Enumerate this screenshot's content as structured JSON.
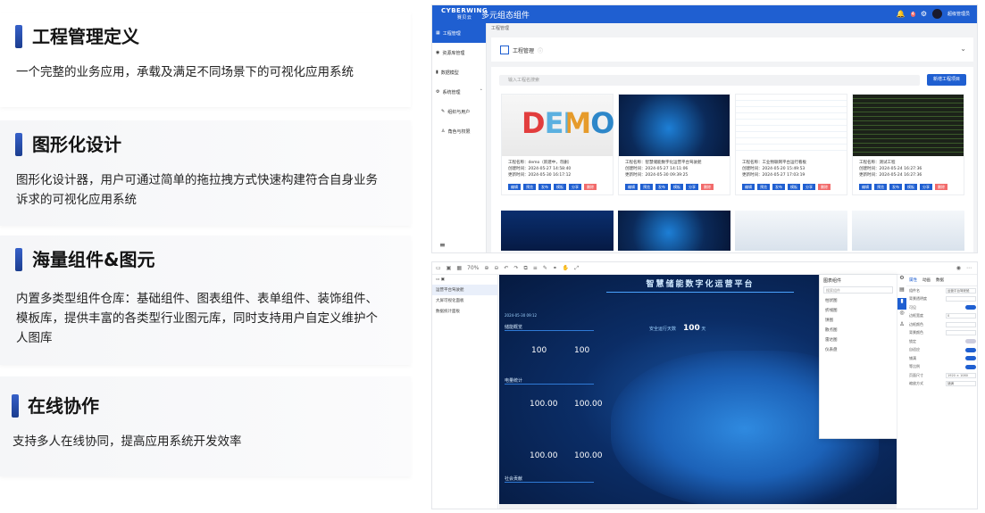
{
  "features": [
    {
      "title": "工程管理定义",
      "desc": "一个完整的业务应用，承载及满足不同场景下的可视化应用系统"
    },
    {
      "title": "图形化设计",
      "desc": "图形化设计器，用户可通过简单的拖拉拽方式快速构建符合自身业务诉求的可视化应用系统"
    },
    {
      "title": "海量组件&图元",
      "desc": "内置多类型组件仓库：基础组件、图表组件、表单组件、装饰组件、模板库，提供丰富的各类型行业图元库，同时支持用户自定义维护个人图库"
    },
    {
      "title": "在线协作",
      "desc": "支持多人在线协同，提高应用系统开发效率"
    }
  ],
  "app": {
    "brand": "CYBERWING",
    "brand_cn": "赛贝云",
    "title": "多元组态组件",
    "user": "超级管理员",
    "notif_count": "4",
    "sidebar": [
      {
        "label": "工程管理",
        "active": true,
        "icon": "grid-icon"
      },
      {
        "label": "资源库管理",
        "icon": "database-icon"
      },
      {
        "label": "数据模型",
        "icon": "chart-icon"
      },
      {
        "label": "系统管理",
        "icon": "gear-icon"
      },
      {
        "label": "组织与用户",
        "icon": "pen-icon",
        "sub": true
      },
      {
        "label": "角色与权限",
        "icon": "user-icon",
        "sub": true
      }
    ],
    "breadcrumb": "工程管理",
    "panel_title": "工程管理",
    "search_placeholder": "输入工程名搜索",
    "new_button": "新增工程项目",
    "card_buttons": [
      "编辑",
      "预览",
      "发布",
      "模板",
      "分享",
      "删除"
    ],
    "projects": [
      {
        "name": "工程名称：demo（新建中，勿删）",
        "created": "创建时间：2024-05-27 14:58:40",
        "updated": "更新时间：2024-05-30 16:17:12"
      },
      {
        "name": "工程名称：智慧储能数字化运营平台驾驶舱",
        "created": "创建时间：2024-05-27 14:11:06",
        "updated": "更新时间：2024-05-30 09:39:25"
      },
      {
        "name": "工程名称：工业物联网平台运行看板",
        "created": "创建时间：2024-05-20 15:49:53",
        "updated": "更新时间：2024-05-27 17:03:19"
      },
      {
        "name": "工程名称：测试工程",
        "created": "创建时间：2024-05-24 16:27:36",
        "updated": "更新时间：2024-05-24 16:27:36"
      }
    ],
    "demo_text": "DEMO"
  },
  "editor": {
    "zoom": "70%",
    "tree": [
      "运营平台驾驶舱",
      "大屏可视化面板",
      "数据统计面板"
    ],
    "dashboard_title": "智慧储能数字化运营平台",
    "datetime": "2024-05-30 09:12",
    "sections": [
      "储能概览",
      "电量统计",
      "社会贡献"
    ],
    "safe_days_label": "安全运行天数",
    "safe_days_value": "100",
    "unit": "天",
    "kpis": [
      "100",
      "100",
      "100.00",
      "100.00",
      "100.00",
      "100.00"
    ],
    "component_panel": {
      "title": "图表组件",
      "search": "搜索组件",
      "groups": [
        "柱状图",
        "折线图",
        "饼图",
        "散点图",
        "雷达图",
        "仪表盘"
      ]
    },
    "props_tabs": [
      "属性",
      "动画",
      "数据"
    ],
    "props_rows": [
      {
        "label": "组件名",
        "value": "运营平台驾驶舱"
      },
      {
        "label": "背景透明度",
        "value": ""
      },
      {
        "label": "可见",
        "toggle": true
      },
      {
        "label": "边框宽度",
        "value": "0"
      },
      {
        "label": "边框颜色",
        "value": ""
      },
      {
        "label": "背景颜色",
        "value": ""
      },
      {
        "label": "锁定",
        "toggle": false
      },
      {
        "label": "自适应",
        "toggle": true
      },
      {
        "label": "铺满",
        "toggle": true
      },
      {
        "label": "等比例",
        "toggle": true
      },
      {
        "label": "页面尺寸",
        "value": "1920 × 1080"
      },
      {
        "label": "缩放方式",
        "value": "铺满"
      }
    ]
  }
}
